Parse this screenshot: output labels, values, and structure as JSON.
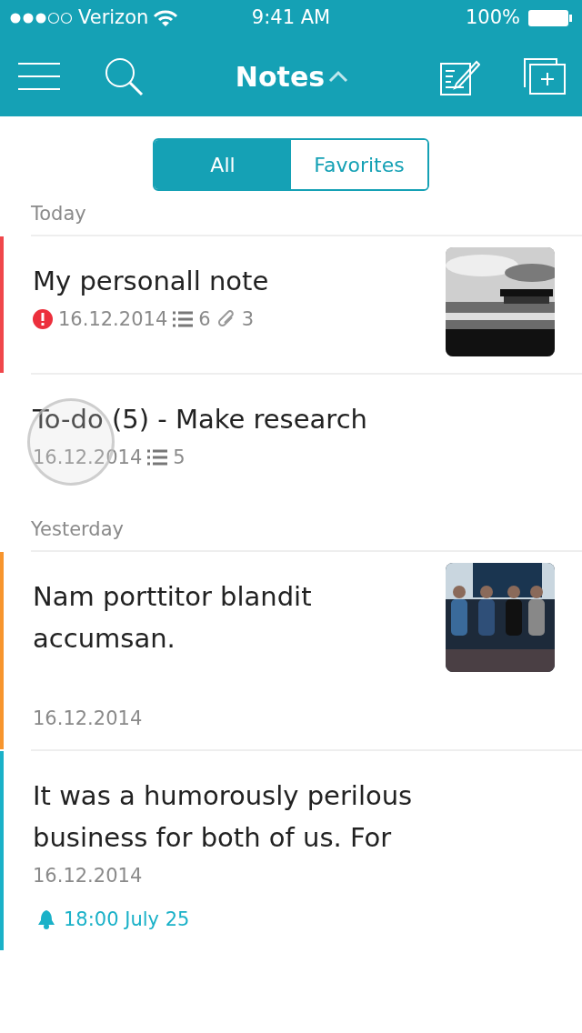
{
  "status_bar": {
    "carrier": "Verizon",
    "time": "9:41 AM",
    "battery": "100%"
  },
  "nav": {
    "title": "Notes"
  },
  "segments": [
    {
      "label": "All",
      "selected": true
    },
    {
      "label": "Favorites",
      "selected": false
    }
  ],
  "sections": [
    {
      "header": "Today",
      "notes": [
        {
          "title": "My personall note",
          "color": "#f0474b",
          "important": true,
          "date": "16.12.2014",
          "checklist": "6",
          "attachments": "3",
          "picture": true,
          "touched": false
        },
        {
          "title": "To-do (5) - Make research",
          "date": "16.12.2014",
          "checklist": "5",
          "important": false,
          "picture": false,
          "touched": true
        }
      ]
    },
    {
      "header": "Yesterday",
      "notes": [
        {
          "title": "Nam porttitor blandit accumsan.",
          "color": "#f7952e",
          "important": false,
          "date": "16.12.2014",
          "picture": true,
          "touched": false
        },
        {
          "title": "It was a humorously perilous business for both of us. For",
          "color": "#1ab1c8",
          "important": false,
          "date": "16.12.2014",
          "reminder": "18:00 July 25",
          "picture": false,
          "touched": false
        }
      ]
    }
  ]
}
